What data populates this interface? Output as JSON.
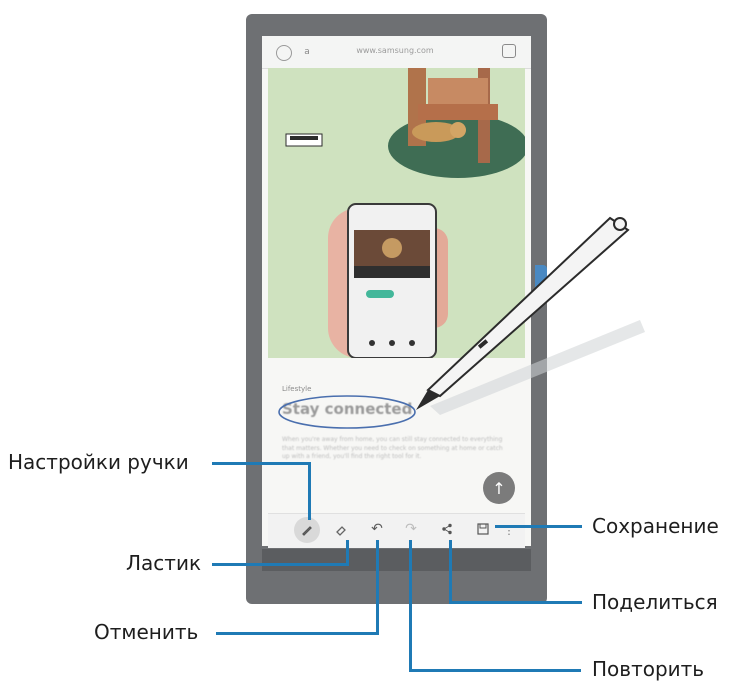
{
  "browser": {
    "url": "www.samsung.com",
    "home_icon": "home-icon",
    "tabs_icon": "tabs-icon"
  },
  "article": {
    "section": "Lifestyle",
    "heading": "Stay connected",
    "body": "When you're away from home, you can still stay connected to everything that matters. Whether you need to check on something at home or catch up with a friend, you'll find the right tool for it."
  },
  "toolbar": {
    "pen_settings_icon": "pen-icon",
    "eraser_icon": "eraser-icon",
    "undo_icon": "undo-icon",
    "redo_icon": "redo-icon",
    "share_icon": "share-icon",
    "save_icon": "save-icon",
    "more_icon": "more-vertical-icon",
    "scroll_up_icon": "arrow-up-icon"
  },
  "callouts": {
    "pen_settings": "Настройки ручки",
    "eraser": "Ластик",
    "undo": "Отменить",
    "redo": "Повторить",
    "share": "Поделиться",
    "save": "Сохранение"
  },
  "colors": {
    "callout_line": "#1f7ab5",
    "hero_background": "#cfe2bf",
    "phone_frame": "#6e7073",
    "annotation_ink": "#4a6fae"
  }
}
